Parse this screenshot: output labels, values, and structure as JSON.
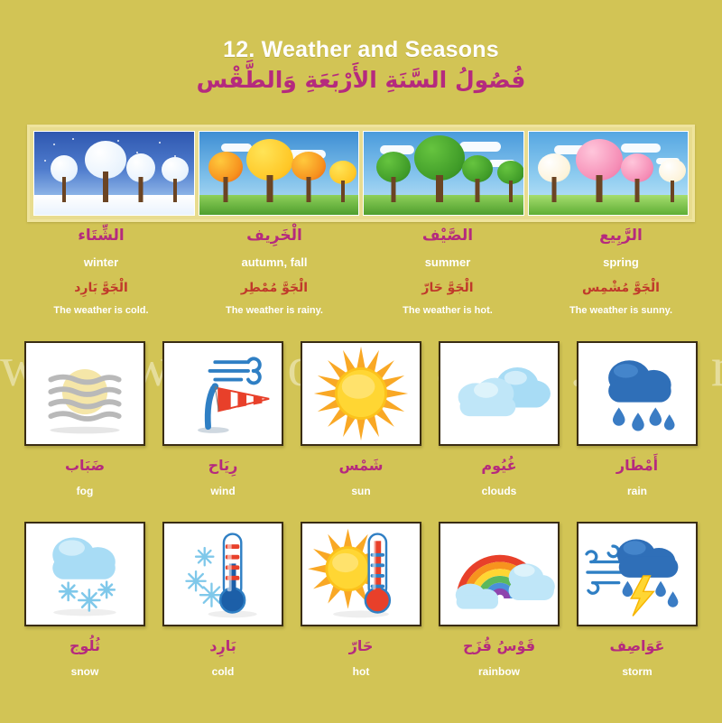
{
  "header": {
    "title_en": "12. Weather and Seasons",
    "title_ar": "فُصُولُ السَّنَةِ الأَرْبَعَةِ وَالطَّقْس"
  },
  "watermark": "w w w . n o o r a r t . c o m",
  "colors": {
    "background": "#d2c455",
    "magenta": "#b52a7e",
    "red": "#c0392b",
    "white": "#ffffff",
    "frame_border": "#3a2d14",
    "strip_frame": "#efe49d"
  },
  "seasons": [
    {
      "arabic": "الشِّتَاء",
      "english": "winter",
      "weather_ar": "الْجَوَّ بَارِد",
      "weather_en": "The weather is cold.",
      "scene": "winter-snow-trees-night-sky"
    },
    {
      "arabic": "الْخَرِيف",
      "english": "autumn, fall",
      "weather_ar": "الْجَوَّ مُمْطِر",
      "weather_en": "The weather is rainy.",
      "scene": "autumn-orange-trees"
    },
    {
      "arabic": "الصَّيْف",
      "english": "summer",
      "weather_ar": "الْجَوَّ حَارّ",
      "weather_en": "The weather is hot.",
      "scene": "summer-green-trees"
    },
    {
      "arabic": "الرَّبِيع",
      "english": "spring",
      "weather_ar": "الْجَوَّ مُشْمِس",
      "weather_en": "The weather is sunny.",
      "scene": "spring-blossom-trees"
    }
  ],
  "weather_cards_row1": [
    {
      "arabic": "ضَبَاب",
      "english": "fog",
      "icon": "fog-icon"
    },
    {
      "arabic": "رِيَاح",
      "english": "wind",
      "icon": "windsock-icon"
    },
    {
      "arabic": "شَمْس",
      "english": "sun",
      "icon": "sun-icon"
    },
    {
      "arabic": "غُيُوم",
      "english": "clouds",
      "icon": "clouds-icon"
    },
    {
      "arabic": "أَمْطَار",
      "english": "rain",
      "icon": "rain-cloud-icon"
    }
  ],
  "weather_cards_row2": [
    {
      "arabic": "ثُلُوج",
      "english": "snow",
      "icon": "snow-cloud-icon"
    },
    {
      "arabic": "بَارِد",
      "english": "cold",
      "icon": "cold-thermometer-icon"
    },
    {
      "arabic": "حَارّ",
      "english": "hot",
      "icon": "hot-thermometer-icon"
    },
    {
      "arabic": "قَوْسُ قُزَح",
      "english": "rainbow",
      "icon": "rainbow-icon"
    },
    {
      "arabic": "عَوَاصِف",
      "english": "storm",
      "icon": "storm-icon"
    }
  ]
}
